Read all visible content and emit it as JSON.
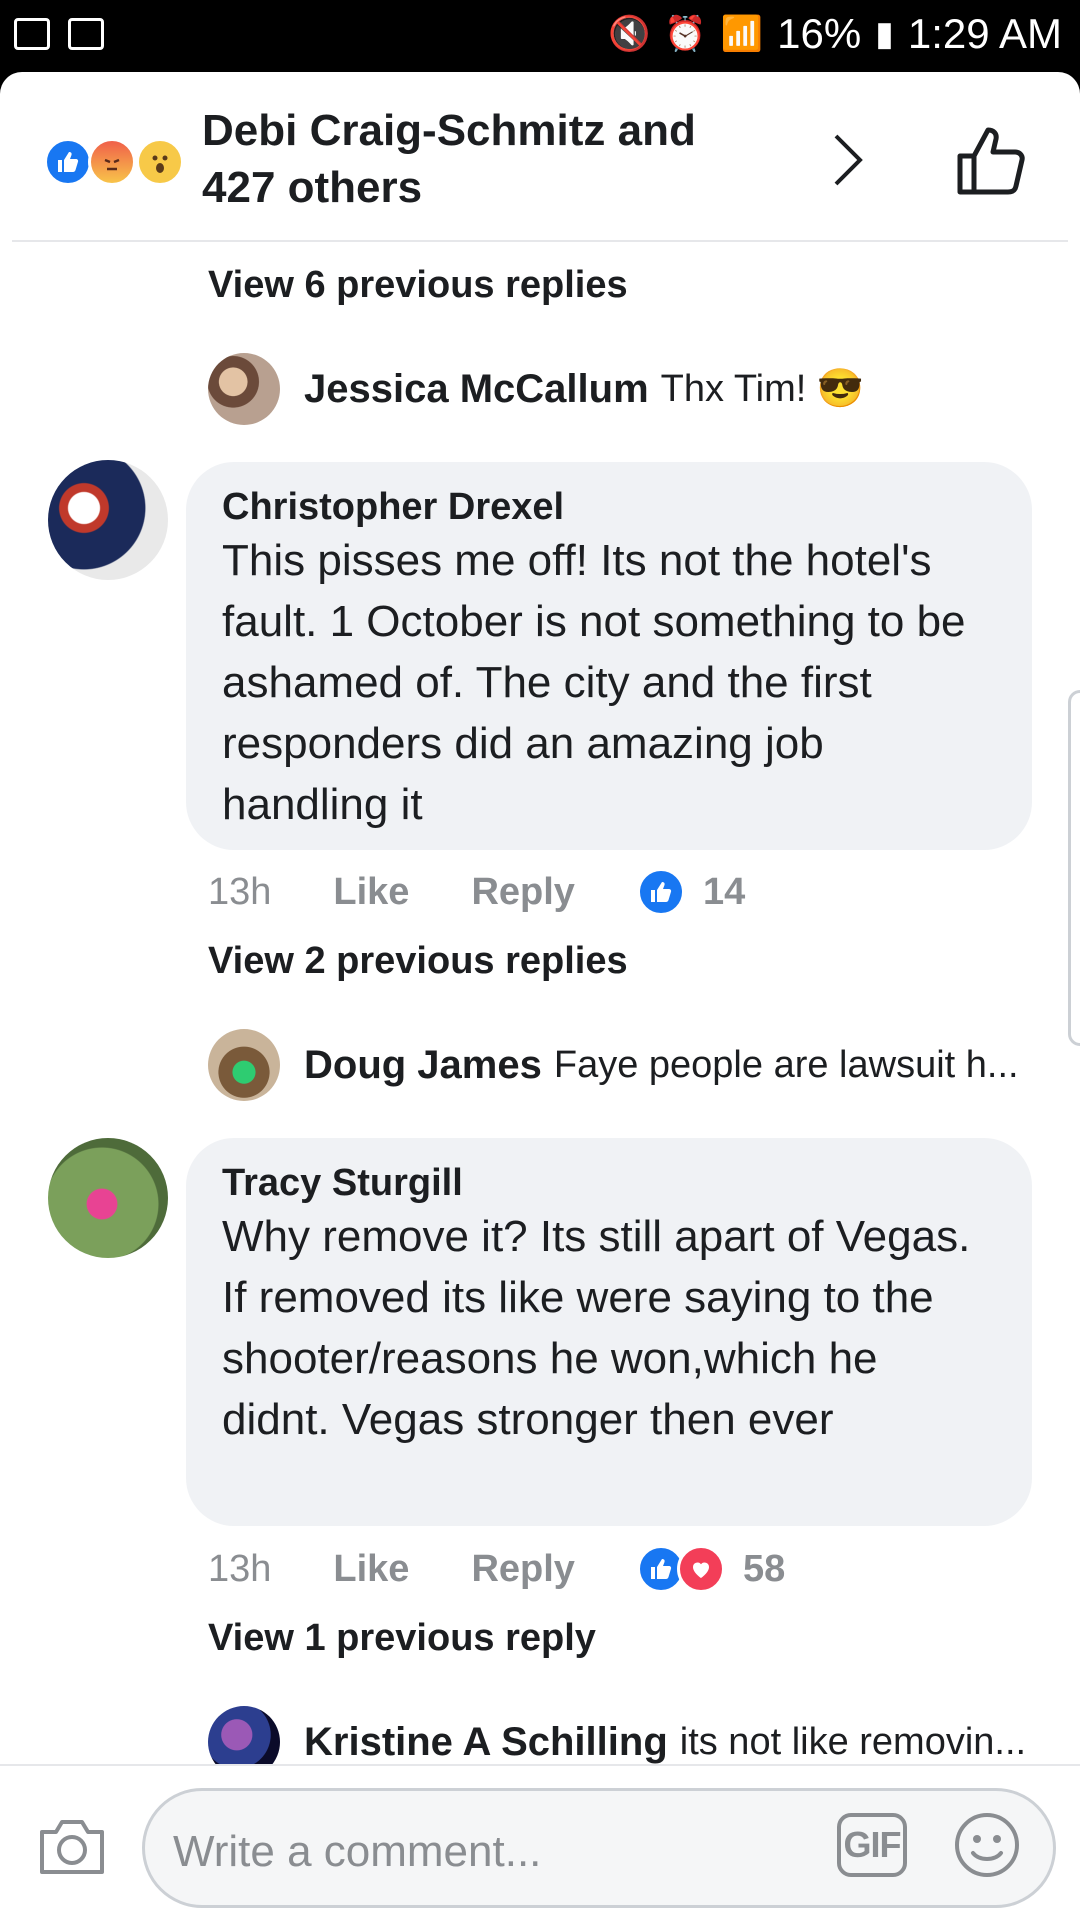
{
  "status_bar": {
    "battery": "16%",
    "time": "1:29 AM"
  },
  "header": {
    "title": "Debi Craig-Schmitz and 427 others",
    "reaction_icons": [
      "like-icon",
      "angry-icon",
      "wow-icon"
    ]
  },
  "comments": [
    {
      "view_previous": "View 6 previous replies",
      "reply": {
        "name": "Jessica McCallum",
        "text": "Thx Tim! 😎"
      }
    },
    {
      "name": "Christopher Drexel",
      "text": "This pisses me off! Its not the hotel's fault. 1 October is not something to be ashamed of. The city and the first responders did an amazing job handling it",
      "time": "13h",
      "like_label": "Like",
      "reply_label": "Reply",
      "reaction_count": "14",
      "view_previous": "View 2 previous replies",
      "reply": {
        "name": "Doug James",
        "text": "Faye people are lawsuit h..."
      }
    },
    {
      "name": "Tracy Sturgill",
      "text": "Why remove it? Its still apart of Vegas. If removed its like were saying to the shooter/reasons he won,which he didnt. Vegas stronger then ever",
      "time": "13h",
      "like_label": "Like",
      "reply_label": "Reply",
      "reaction_count": "58",
      "view_previous": "View 1 previous reply",
      "reply": {
        "name": "Kristine A Schilling",
        "text": "its not like removin..."
      }
    }
  ],
  "composer": {
    "placeholder": "Write a comment...",
    "gif_label": "GIF"
  },
  "colors": {
    "accent": "#1877f2",
    "love": "#f33e58",
    "bubble": "#f0f2f5",
    "muted": "#8a8d91"
  }
}
